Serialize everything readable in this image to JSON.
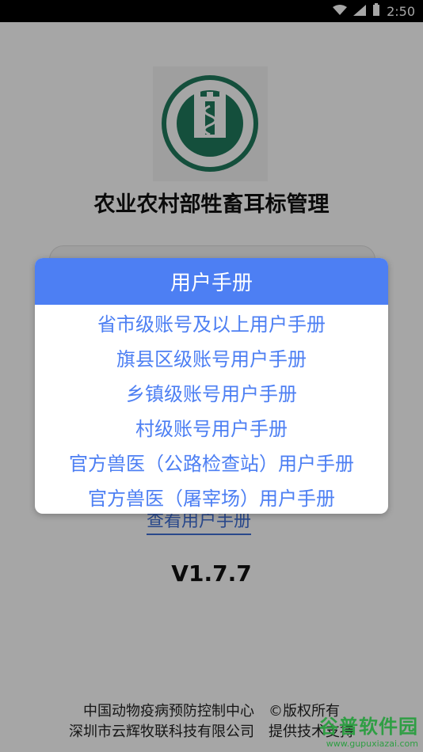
{
  "status_bar": {
    "time": "2:50"
  },
  "app": {
    "title": "农业农村部牲畜耳标管理",
    "view_manual_link": "查看用户手册",
    "version": "V1.7.7",
    "footer_line1": "中国动物疫病预防控制中心　©版权所有",
    "footer_line2": "深圳市云辉牧联科技有限公司　提供技术支持"
  },
  "dialog": {
    "title": "用户手册",
    "items": [
      "省市级账号及以上用户手册",
      "旗县区级账号用户手册",
      "乡镇级账号用户手册",
      "村级账号用户手册",
      "官方兽医（公路检查站）用户手册",
      "官方兽医（屠宰场）用户手册"
    ]
  },
  "watermark": {
    "main": "谷普软件园",
    "sub": "www.gupuxiazai.com"
  },
  "colors": {
    "accent": "#4d7ff3",
    "link": "#3f6fd6",
    "logo_green": "#1f7a5c"
  }
}
